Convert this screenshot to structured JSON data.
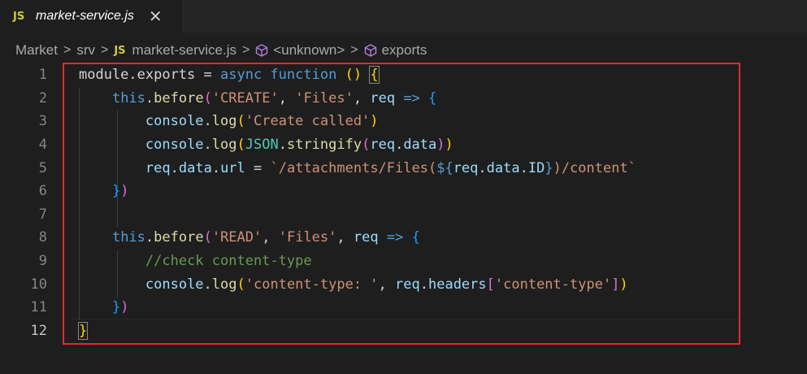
{
  "tab": {
    "badge": "JS",
    "title": "market-service.js",
    "close": "✕"
  },
  "breadcrumb": {
    "items": [
      "Market",
      "srv",
      "market-service.js",
      "<unknown>",
      "exports"
    ],
    "js_badge": "JS",
    "sep": "›"
  },
  "editor": {
    "line_numbers": [
      "1",
      "2",
      "3",
      "4",
      "5",
      "6",
      "7",
      "8",
      "9",
      "10",
      "11",
      "12"
    ],
    "current_line": 12
  },
  "colors": {
    "highlight_border": "#e8262d",
    "js_badge": "#cbcb41"
  }
}
